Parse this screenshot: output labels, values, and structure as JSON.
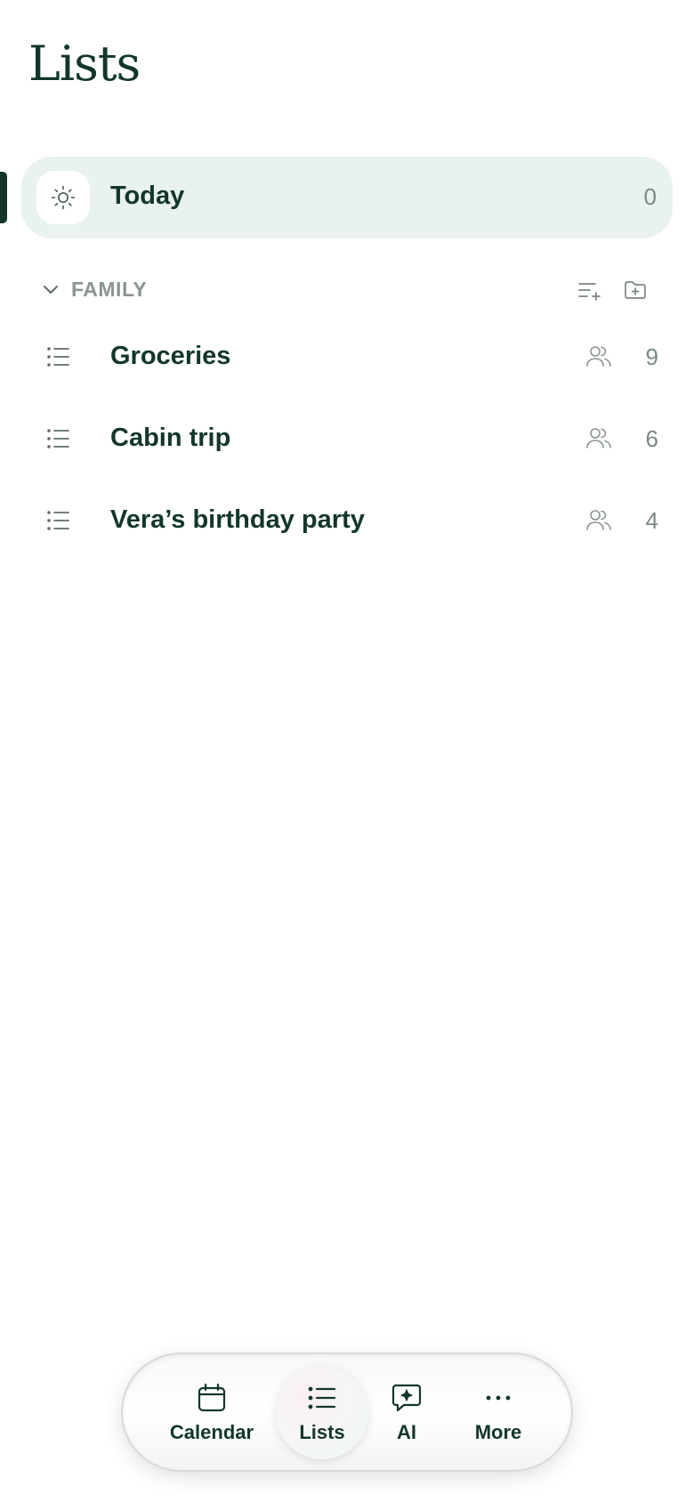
{
  "header": {
    "title": "Lists"
  },
  "today": {
    "label": "Today",
    "count": "0",
    "icon": "sun-icon"
  },
  "section": {
    "label": "FAMILY",
    "icons": [
      "chevron-down-icon",
      "add-list-icon",
      "add-folder-icon"
    ]
  },
  "lists": [
    {
      "label": "Groceries",
      "count": "9",
      "icon": "list-icon",
      "shared_icon": "people-icon"
    },
    {
      "label": "Cabin trip",
      "count": "6",
      "icon": "list-icon",
      "shared_icon": "people-icon"
    },
    {
      "label": "Vera’s birthday party",
      "count": "4",
      "icon": "list-icon",
      "shared_icon": "people-icon"
    }
  ],
  "nav": {
    "items": [
      {
        "label": "Calendar",
        "icon": "calendar-icon"
      },
      {
        "label": "Lists",
        "icon": "list-icon",
        "active": true
      },
      {
        "label": "AI",
        "icon": "ai-chat-icon"
      },
      {
        "label": "More",
        "icon": "more-icon"
      }
    ]
  },
  "colors": {
    "primary": "#12372a",
    "active_bg": "#eaf2ee",
    "muted": "#7a8a82"
  }
}
